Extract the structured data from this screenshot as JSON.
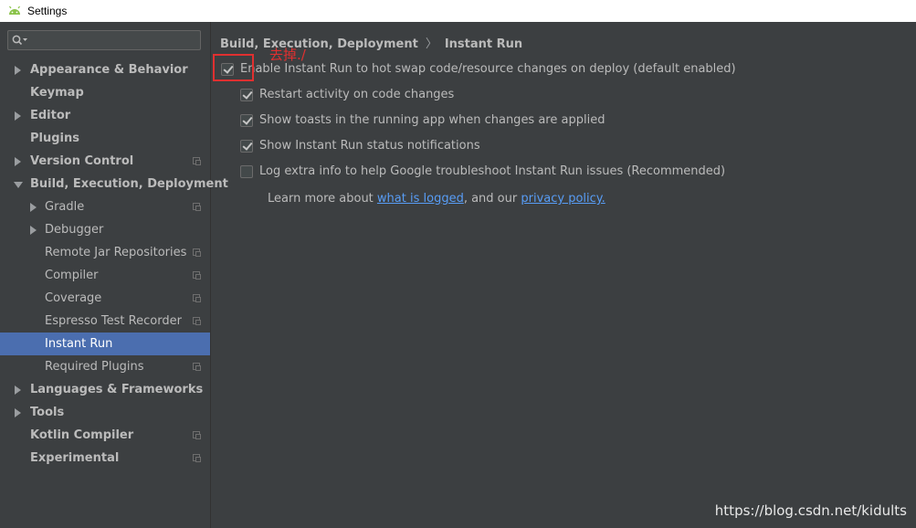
{
  "window": {
    "title": "Settings"
  },
  "search": {
    "placeholder": "",
    "value": ""
  },
  "sidebar": {
    "items": [
      {
        "label": "Appearance & Behavior",
        "level": 0,
        "arrow": "right",
        "proj": false
      },
      {
        "label": "Keymap",
        "level": 0,
        "arrow": "none",
        "proj": false
      },
      {
        "label": "Editor",
        "level": 0,
        "arrow": "right",
        "proj": false
      },
      {
        "label": "Plugins",
        "level": 0,
        "arrow": "none",
        "proj": false
      },
      {
        "label": "Version Control",
        "level": 0,
        "arrow": "right",
        "proj": true
      },
      {
        "label": "Build, Execution, Deployment",
        "level": 0,
        "arrow": "down",
        "proj": false
      },
      {
        "label": "Gradle",
        "level": 1,
        "arrow": "right",
        "proj": true
      },
      {
        "label": "Debugger",
        "level": 1,
        "arrow": "right",
        "proj": false
      },
      {
        "label": "Remote Jar Repositories",
        "level": 1,
        "arrow": "none",
        "proj": true
      },
      {
        "label": "Compiler",
        "level": 1,
        "arrow": "none",
        "proj": true
      },
      {
        "label": "Coverage",
        "level": 1,
        "arrow": "none",
        "proj": true
      },
      {
        "label": "Espresso Test Recorder",
        "level": 1,
        "arrow": "none",
        "proj": true
      },
      {
        "label": "Instant Run",
        "level": 1,
        "arrow": "none",
        "proj": false,
        "selected": true
      },
      {
        "label": "Required Plugins",
        "level": 1,
        "arrow": "none",
        "proj": true
      },
      {
        "label": "Languages & Frameworks",
        "level": 0,
        "arrow": "right",
        "proj": false
      },
      {
        "label": "Tools",
        "level": 0,
        "arrow": "right",
        "proj": false
      },
      {
        "label": "Kotlin Compiler",
        "level": 0,
        "arrow": "none",
        "proj": true
      },
      {
        "label": "Experimental",
        "level": 0,
        "arrow": "none",
        "proj": true
      }
    ]
  },
  "breadcrumb": {
    "parent": "Build, Execution, Deployment",
    "separator": "〉",
    "current": "Instant Run"
  },
  "options": [
    {
      "label": "Enable Instant Run to hot swap code/resource changes on deploy (default enabled)",
      "checked": true
    },
    {
      "label": "Restart activity on code changes",
      "checked": true
    },
    {
      "label": "Show toasts in the running app when changes are applied",
      "checked": true
    },
    {
      "label": "Show Instant Run status notifications",
      "checked": true
    },
    {
      "label": "Log extra info to help Google troubleshoot Instant Run issues (Recommended)",
      "checked": false
    }
  ],
  "learn": {
    "prefix": "Learn more about",
    "link1": "what is logged",
    "middle": ", and our",
    "link2": "privacy policy."
  },
  "annotation": {
    "text": "去掉./"
  },
  "watermark": {
    "text": "https://blog.csdn.net/kidults"
  },
  "colors": {
    "background": "#3c3f41",
    "selection": "#4b6eaf",
    "link": "#589df6",
    "annotation": "#e03030"
  }
}
